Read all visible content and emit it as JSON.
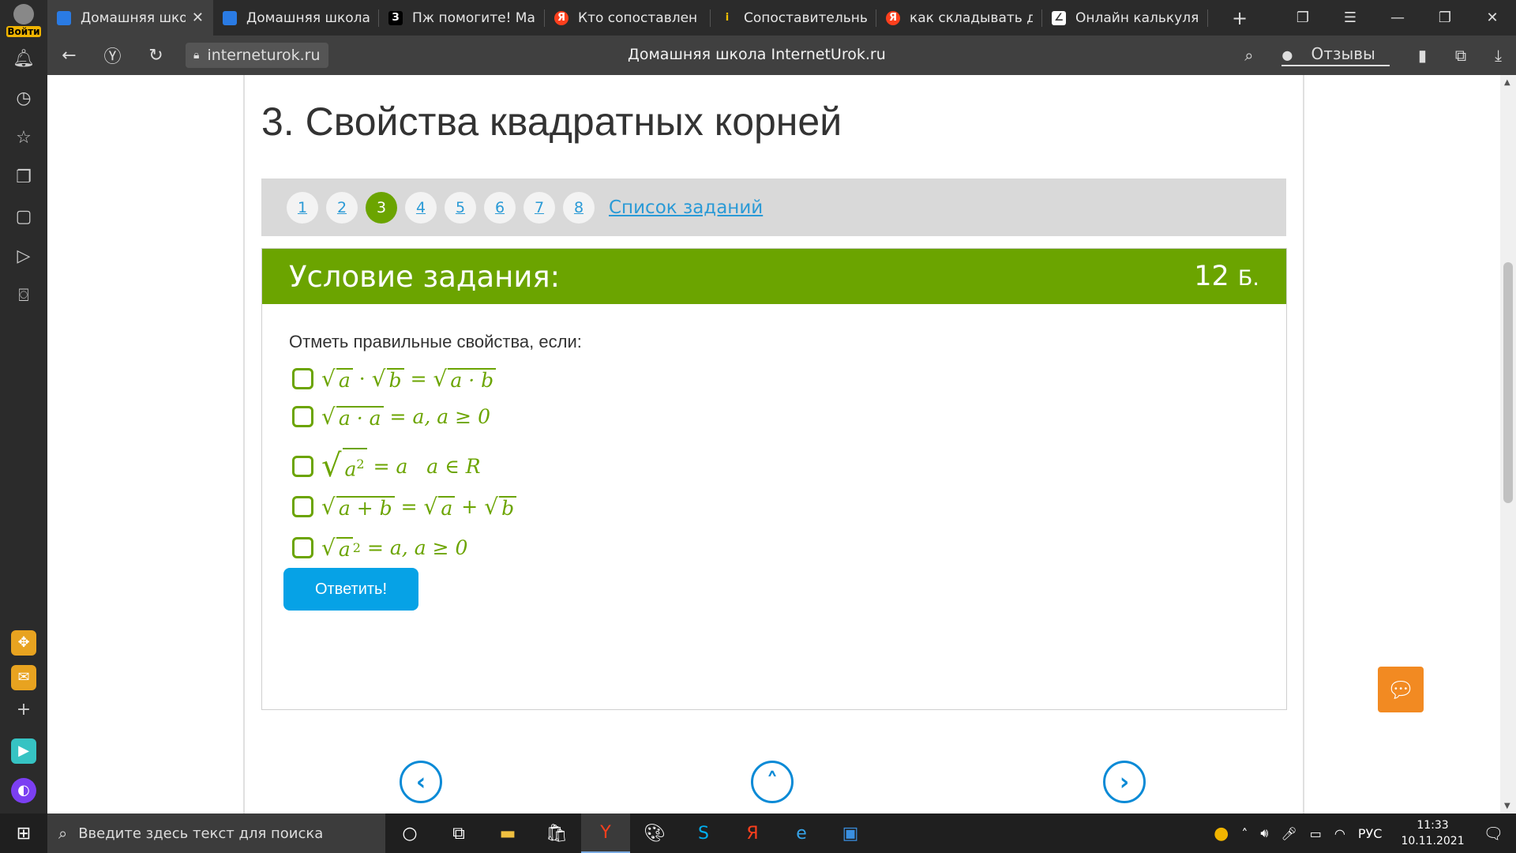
{
  "browser": {
    "tabs": [
      {
        "title": "Домашняя школа",
        "favicon": "ir-icon",
        "fav_color": "#2a7be4",
        "fav_text": "",
        "active": true
      },
      {
        "title": "Домашняя школа Int",
        "favicon": "ir-icon",
        "fav_color": "#2a7be4",
        "fav_text": "",
        "active": false
      },
      {
        "title": "Пж помогите! Матем",
        "favicon": "znanija-icon",
        "fav_color": "#000000",
        "fav_text": "З",
        "active": false
      },
      {
        "title": "Кто сопоставлен в с",
        "favicon": "yandex-icon",
        "fav_color": "#fc3f1d",
        "fav_text": "Я",
        "active": false
      },
      {
        "title": "Сопоставительный а",
        "favicon": "info-icon",
        "fav_color": "#2b2b2b",
        "fav_text": "i",
        "active": false
      },
      {
        "title": "как складывать дроб",
        "favicon": "yandex-icon",
        "fav_color": "#fc3f1d",
        "fav_text": "Я",
        "active": false
      },
      {
        "title": "Онлайн калькулятор",
        "favicon": "calculator-icon",
        "fav_color": "#ffffff",
        "fav_text": "",
        "active": false
      }
    ],
    "url": "interneturok.ru",
    "page_title": "Домашняя школа InternetUrok.ru",
    "reviews_label": "Отзывы",
    "login_label": "Войти"
  },
  "lesson": {
    "title": "3. Свойства квадратных корней",
    "pages": [
      "1",
      "2",
      "3",
      "4",
      "5",
      "6",
      "7",
      "8"
    ],
    "current_page": "3",
    "task_list_label": "Список заданий"
  },
  "task": {
    "header": "Условие задания:",
    "points": "12",
    "points_unit": "Б.",
    "question": "Отметь правильные свойства, если:",
    "answer_label": "Ответить!"
  },
  "taskbar": {
    "search_placeholder": "Введите здесь текст для поиска",
    "language": "РУС",
    "time": "11:33",
    "date": "10.11.2021"
  },
  "colors": {
    "accent_green": "#6ba400",
    "answer_blue": "#06a2e6",
    "chat_orange": "#f28a22"
  }
}
